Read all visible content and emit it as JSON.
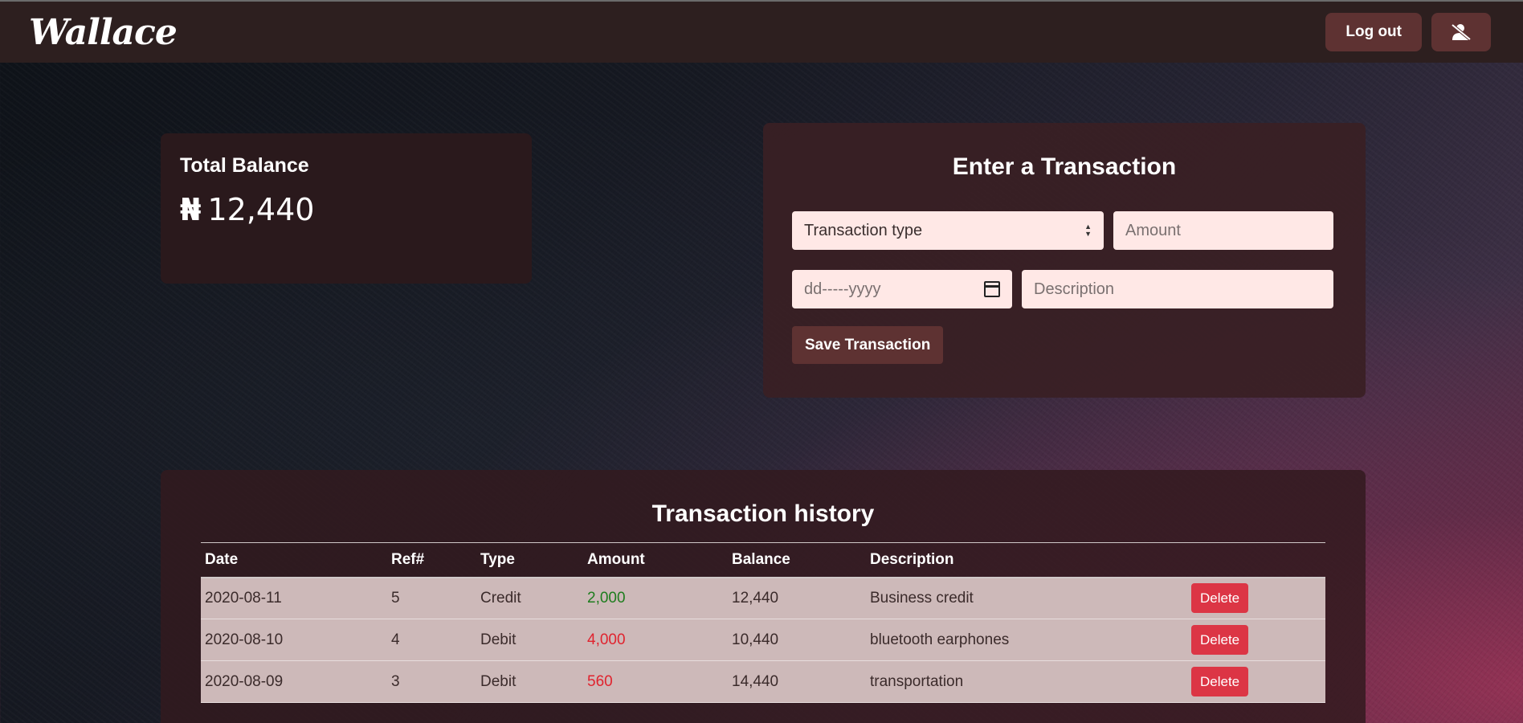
{
  "navbar": {
    "logo": "Wallace",
    "logout_label": "Log out",
    "user_icon": "user-slash-icon"
  },
  "balance": {
    "title": "Total Balance",
    "currency": "₦",
    "amount": "12,440"
  },
  "transaction_form": {
    "title": "Enter a Transaction",
    "type_placeholder": "Transaction type",
    "amount_placeholder": "Amount",
    "date_placeholder": "dd-----yyyy",
    "description_placeholder": "Description",
    "save_label": "Save Transaction"
  },
  "history": {
    "title": "Transaction history",
    "columns": [
      "Date",
      "Ref#",
      "Type",
      "Amount",
      "Balance",
      "Description",
      ""
    ],
    "rows": [
      {
        "date": "2020-08-11",
        "ref": "5",
        "type": "Credit",
        "amount": "2,000",
        "balance": "12,440",
        "description": "Business credit",
        "action": "Delete"
      },
      {
        "date": "2020-08-10",
        "ref": "4",
        "type": "Debit",
        "amount": "4,000",
        "balance": "10,440",
        "description": "bluetooth earphones",
        "action": "Delete"
      },
      {
        "date": "2020-08-09",
        "ref": "3",
        "type": "Debit",
        "amount": "560",
        "balance": "14,440",
        "description": "transportation",
        "action": "Delete"
      }
    ]
  },
  "colors": {
    "navbar_bg": "#2d1f1f",
    "button_bg": "#5e3232",
    "credit": "#1e7d1e",
    "debit": "#e0232e",
    "delete_bg": "#dc3545"
  }
}
